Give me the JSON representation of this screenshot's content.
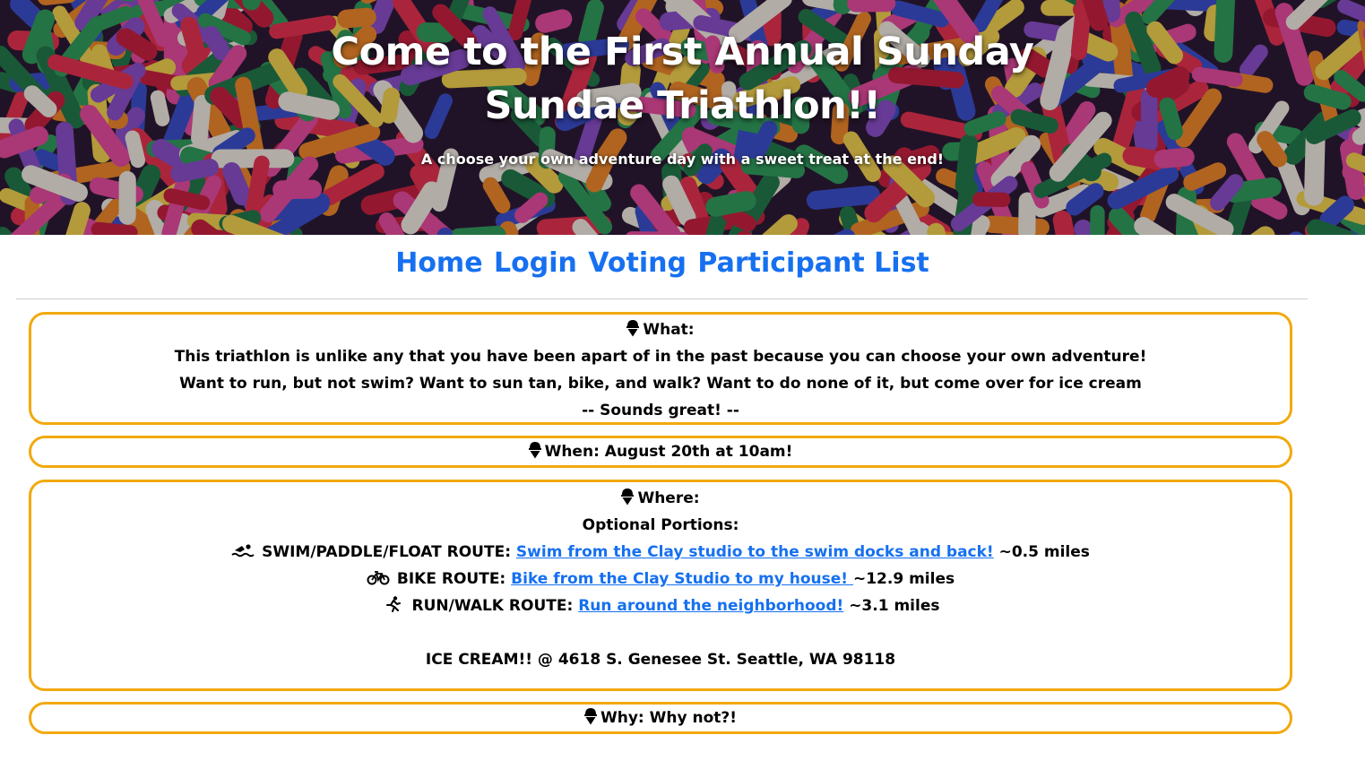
{
  "hero": {
    "title": "Come to the First Annual Sunday Sundae Triathlon!!",
    "subtitle": "A choose your own adventure day with a sweet treat at the end!"
  },
  "nav": {
    "items": [
      {
        "label": "Home"
      },
      {
        "label": "Login"
      },
      {
        "label": "Voting"
      },
      {
        "label": "Participant List"
      }
    ]
  },
  "what": {
    "heading": "What:",
    "lines": [
      "This triathlon is unlike any that you have been apart of in the past because you can choose your own adventure!",
      "Want to run, but not swim? Want to sun tan, bike, and walk? Want to do none of it, but come over for ice cream",
      "-- Sounds great! --"
    ]
  },
  "when": {
    "text": "When: August 20th at 10am!"
  },
  "where": {
    "heading": "Where:",
    "optional": "Optional Portions:",
    "routes": [
      {
        "icon": "swimmer-icon",
        "label": "SWIM/PADDLE/FLOAT ROUTE:",
        "link": "Swim from the Clay studio to the swim docks and back!",
        "distance": "~0.5 miles"
      },
      {
        "icon": "bicycle-icon",
        "label": "BIKE ROUTE:",
        "link": "Bike from the Clay Studio to my house! ",
        "distance": "~12.9 miles"
      },
      {
        "icon": "runner-icon",
        "label": "RUN/WALK ROUTE:",
        "link": "Run around the neighborhood!",
        "distance": "~3.1 miles"
      }
    ],
    "ice_cream": "ICE CREAM!! @ 4618 S. Genesee St. Seattle, WA 98118"
  },
  "why": {
    "text": "Why: Why not?!"
  },
  "colors": {
    "accent_border": "#f2a90f",
    "link": "#1670f0"
  }
}
